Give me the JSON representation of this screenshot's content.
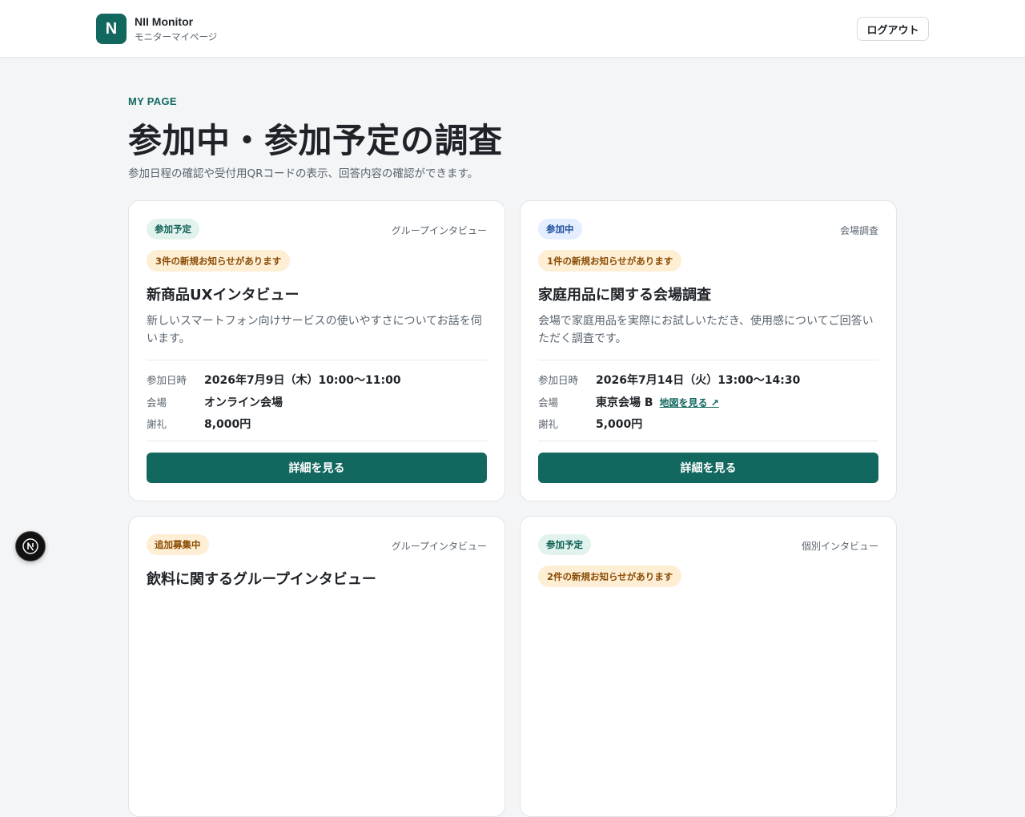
{
  "header": {
    "logo_letter": "N",
    "brand_name": "NII Monitor",
    "brand_sub": "モニターマイページ",
    "logout_label": "ログアウト"
  },
  "page": {
    "eyebrow": "MY PAGE",
    "title": "参加中・参加予定の調査",
    "description": "参加日程の確認や受付用QRコードの表示、回答内容の確認ができます。"
  },
  "labels": {
    "date": "参加日時",
    "venue": "会場",
    "reward": "謝礼",
    "detail_button": "詳細を見る",
    "map_link": "地図を見る ↗"
  },
  "cards": [
    {
      "status": "参加予定",
      "type": "グループインタビュー",
      "notice": "3件の新規お知らせがあります",
      "title": "新商品UXインタビュー",
      "description": "新しいスマートフォン向けサービスの使いやすさについてお話を伺います。",
      "date": "2026年7月9日（木）10:00〜11:00",
      "venue": "オンライン会場",
      "reward": "8,000円"
    },
    {
      "status": "参加中",
      "type": "会場調査",
      "notice": "1件の新規お知らせがあります",
      "title": "家庭用品に関する会場調査",
      "description": "会場で家庭用品を実際にお試しいただき、使用感についてご回答いただく調査です。",
      "date": "2026年7月14日（火）13:00〜14:30",
      "venue": "東京会場 B",
      "reward": "5,000円"
    },
    {
      "status": "追加募集中",
      "type": "グループインタビュー",
      "title": "飲料に関するグループインタビュー"
    },
    {
      "status": "参加予定",
      "type": "個別インタビュー",
      "notice": "2件の新規お知らせがあります"
    }
  ],
  "colors": {
    "brand": "#12685f",
    "background": "#f3f5f7",
    "badge_green_bg": "#e2f3ee",
    "badge_blue_bg": "#e5eeff",
    "notice_bg": "#fdeed4"
  },
  "fab": {
    "icon": "nextjs-n-icon"
  }
}
